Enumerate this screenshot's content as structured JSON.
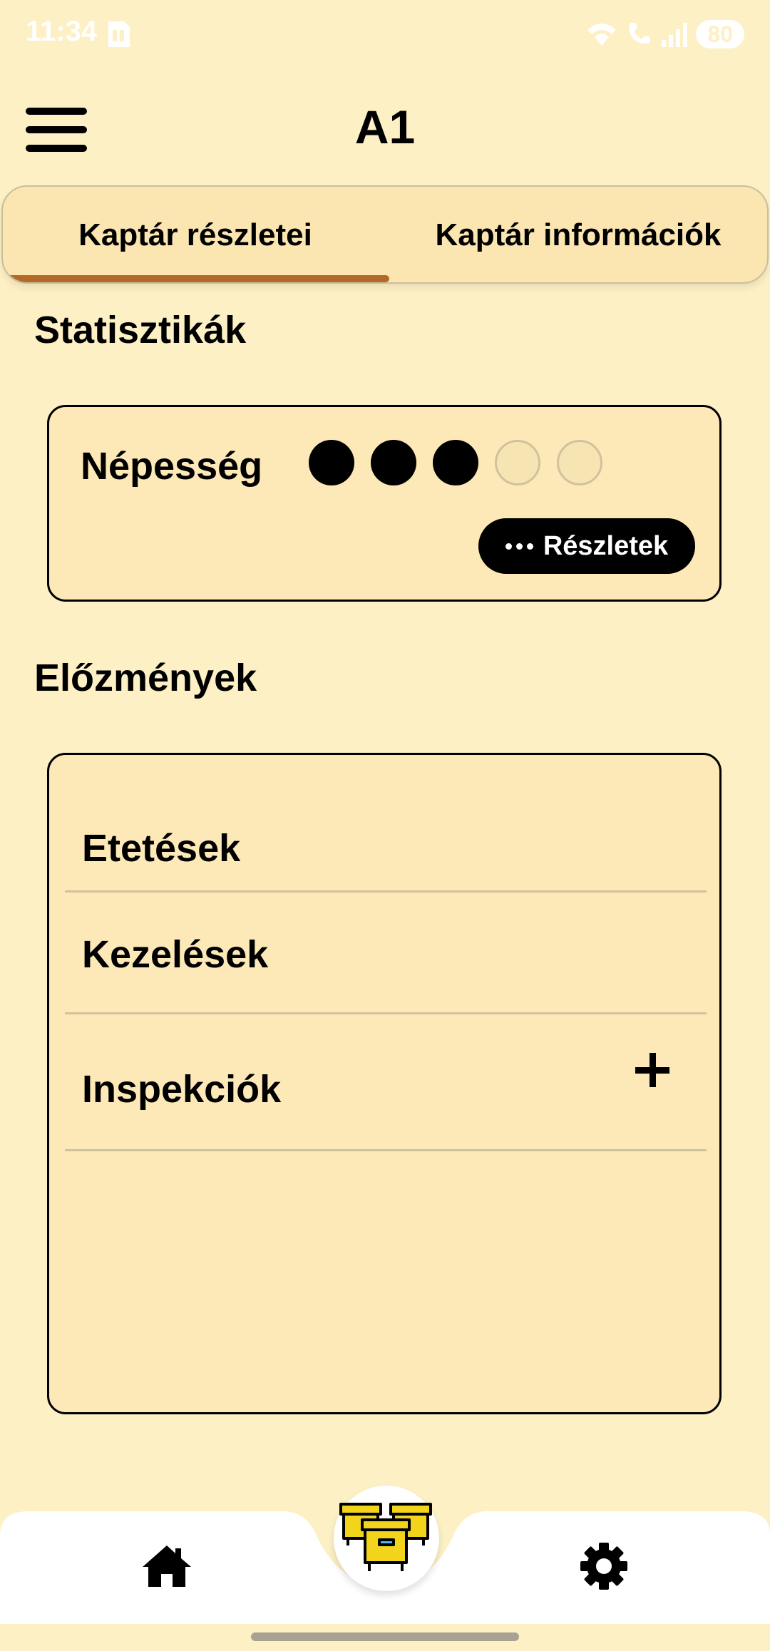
{
  "status_bar": {
    "time": "11:34",
    "battery": "80"
  },
  "header": {
    "title": "A1"
  },
  "tabs": [
    {
      "label": "Kaptár részletei",
      "active": true
    },
    {
      "label": "Kaptár információk",
      "active": false
    }
  ],
  "stats": {
    "section_title": "Statisztikák",
    "population_label": "Népesség",
    "population_level": 3,
    "population_max": 5,
    "details_button": "Részletek"
  },
  "history": {
    "section_title": "Előzmények",
    "items": [
      {
        "label": "Etetések"
      },
      {
        "label": "Kezelések"
      },
      {
        "label": "Inspekciók"
      }
    ]
  },
  "bottom_nav": {
    "items": [
      "home-icon",
      "hives-icon",
      "settings-icon"
    ]
  },
  "colors": {
    "background": "#FDF0C5",
    "card": "#FDE8B7",
    "accent": "#B36A28",
    "hive_yellow": "#F2D41B"
  }
}
